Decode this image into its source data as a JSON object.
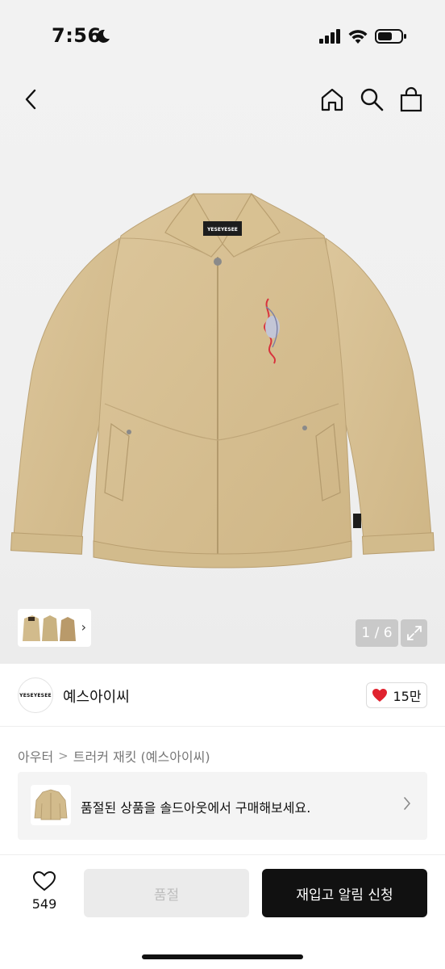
{
  "status_bar": {
    "time": "7:56"
  },
  "product_image": {
    "brand_label": "YESEYESEE",
    "body_color": "#d6bf92",
    "page_indicator": "1 / 6"
  },
  "brand": {
    "logo_text": "YESEYESEE",
    "name": "예스아이씨",
    "likes": "15만"
  },
  "breadcrumb": {
    "category": "아우터",
    "separator": ">",
    "product": "트러커 재킷 (예스아이씨)"
  },
  "soldout_banner": {
    "text": "품절된 상품을 솔드아웃에서 구매해보세요."
  },
  "bottom_bar": {
    "wish_count": "549",
    "soldout_label": "품절",
    "restock_label": "재입고 알림 신청"
  },
  "colors": {
    "accent_dark": "#111111",
    "like_heart": "#e0222e",
    "disabled_bg": "#ebebeb"
  }
}
